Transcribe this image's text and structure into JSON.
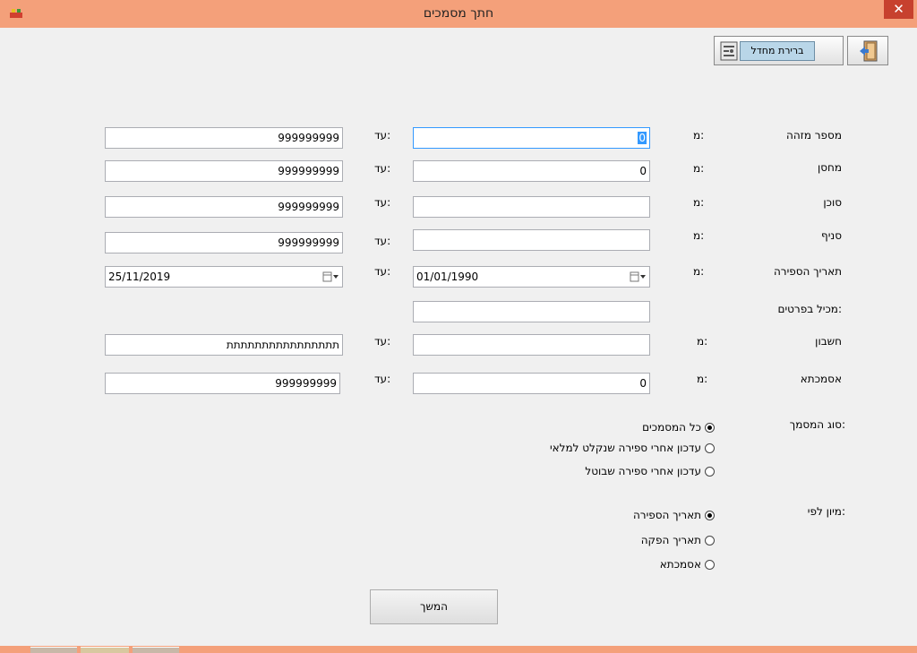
{
  "window": {
    "title": "חתך מסמכים",
    "close_glyph": "✕"
  },
  "toolbar": {
    "report_label": "ברירת מחדל"
  },
  "labels": {
    "from": "מ:",
    "to": "עד:"
  },
  "rows": [
    {
      "label": "מספר מזהה",
      "from_value": "0",
      "to_value": "999999999"
    },
    {
      "label": "מחסן",
      "from_value": "0",
      "to_value": "999999999"
    },
    {
      "label": "סוכן",
      "from_value": "",
      "to_value": "999999999"
    },
    {
      "label": "סניף",
      "from_value": "",
      "to_value": "999999999"
    },
    {
      "label": "תאריך הספירה",
      "from_value": "01/01/1990",
      "to_value": "25/11/2019"
    },
    {
      "label": "מכיל בפרטים:",
      "from_value": ""
    },
    {
      "label": "חשבון",
      "from_value": "",
      "to_value": "תתתתתתתתתתתתתתתת"
    },
    {
      "label": "אסמכתא",
      "from_value": "0",
      "to_value": "999999999"
    }
  ],
  "doc_type": {
    "label": "סוג המסמך:",
    "options": [
      "כל המסמכים",
      "עדכון אחרי ספירה שנקלט למלאי",
      "עדכון אחרי ספירה שבוטל"
    ],
    "selected_index": 0
  },
  "sort_by": {
    "label": "מיון לפי:",
    "options": [
      "תאריך הספירה",
      "תאריך הפקה",
      "אסמכתא"
    ],
    "selected_index": 0
  },
  "continue_label": "המשך",
  "colors": {
    "titlebar": "#f4a07a",
    "close": "#c7412e",
    "focus": "#3399ff"
  },
  "icons": [
    "app-icon",
    "close-icon",
    "report-icon",
    "exit-door-icon",
    "calendar-icon"
  ]
}
